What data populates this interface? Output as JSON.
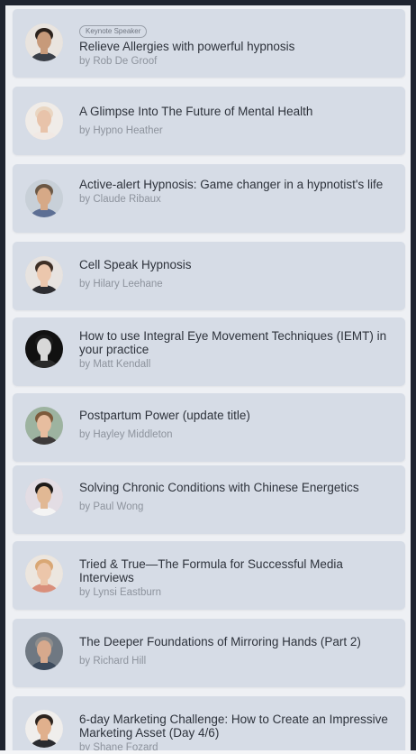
{
  "sessions": [
    {
      "badge": "Keynote Speaker",
      "title": "Relieve Allergies with powerful hypnosis",
      "author": "by Rob De Groof",
      "avatar_icon": "speaker-portrait-icon",
      "skin": "#c79a7a",
      "hair": "#2b221c",
      "shirt": "#3a3f48",
      "bg": "#e9e4df"
    },
    {
      "title": "A Glimpse Into The Future of Mental Health",
      "author": "by Hypno Heather",
      "avatar_icon": "speaker-portrait-icon",
      "skin": "#e8c3aa",
      "hair": "#e9d6c2",
      "shirt": "#f1e9e4",
      "bg": "#f0ece8"
    },
    {
      "title": "Active-alert Hypnosis: Game changer in a hypnotist's life",
      "author": "by Claude Ribaux",
      "avatar_icon": "speaker-portrait-icon",
      "skin": "#d6a987",
      "hair": "#6b5845",
      "shirt": "#5d6f94",
      "bg": "#c8d0d8"
    },
    {
      "title": "Cell Speak Hypnosis",
      "author": "by Hilary Leehane",
      "avatar_icon": "speaker-portrait-icon",
      "skin": "#ecc7ad",
      "hair": "#3e2f25",
      "shirt": "#2d2d31",
      "bg": "#e7e3e0"
    },
    {
      "title": "How to use Integral Eye Movement Techniques (IEMT) in your practice",
      "author": "by Matt Kendall",
      "avatar_icon": "speaker-portrait-icon",
      "skin": "#d8d8d8",
      "hair": "#1b1b1b",
      "shirt": "#2a2a2a",
      "bg": "#111111"
    },
    {
      "title": "Postpartum Power (update title)",
      "author": "by Hayley Middleton",
      "avatar_icon": "speaker-portrait-icon",
      "skin": "#e7bd9f",
      "hair": "#7d5a3b",
      "shirt": "#3d3a3a",
      "bg": "#9db3a0"
    },
    {
      "title": "Solving Chronic Conditions with Chinese Energetics",
      "author": "by Paul Wong",
      "avatar_icon": "speaker-portrait-icon",
      "skin": "#e1b894",
      "hair": "#1d1a18",
      "shirt": "#f4f4f4",
      "bg": "#e3dde4"
    },
    {
      "title": "Tried & True—The Formula for Successful Media Interviews",
      "author": "by Lynsi Eastburn",
      "avatar_icon": "speaker-portrait-icon",
      "skin": "#ecc6aa",
      "hair": "#d9a774",
      "shirt": "#d98f7b",
      "bg": "#ece6df"
    },
    {
      "title": "The Deeper Foundations of Mirroring Hands (Part 2)",
      "author": "by Richard Hill",
      "avatar_icon": "speaker-portrait-icon",
      "skin": "#d7a98d",
      "hair": "#8d8d8d",
      "shirt": "#3c4a5c",
      "bg": "#6f7882"
    },
    {
      "title": "6-day Marketing Challenge: How to Create an Impressive Marketing Asset (Day 4/6)",
      "author": "by Shane Fozard",
      "avatar_icon": "speaker-portrait-icon",
      "skin": "#e0b08d",
      "hair": "#2c231d",
      "shirt": "#2a2b2f",
      "bg": "#f0eeec"
    }
  ]
}
